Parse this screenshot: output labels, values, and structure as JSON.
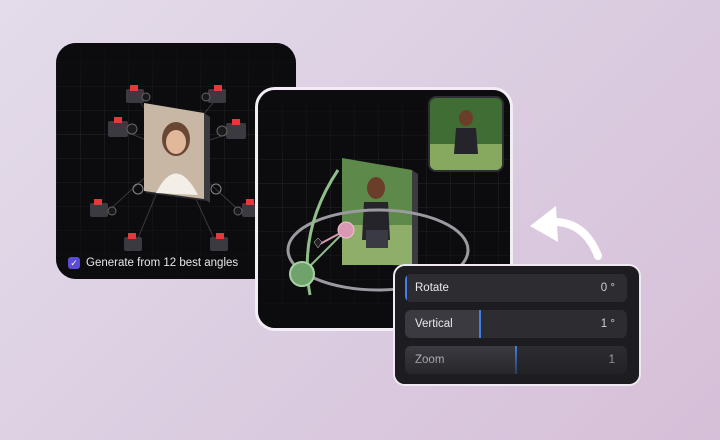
{
  "left_card": {
    "checkbox_label": "Generate from 12 best angles",
    "checkbox_checked": true
  },
  "panel": {
    "rows": [
      {
        "label": "Rotate",
        "value": "0 °",
        "level": 0.0
      },
      {
        "label": "Vertical",
        "value": "1 °",
        "level": 0.34
      },
      {
        "label": "Zoom",
        "value": "1",
        "level": 0.5
      }
    ]
  },
  "colors": {
    "accent": "#3f7fe6",
    "checkbox": "#5b4bd6",
    "orbit_green": "#8fc08a",
    "orbit_pink": "#d998b3",
    "camera_red": "#e23a3a"
  }
}
